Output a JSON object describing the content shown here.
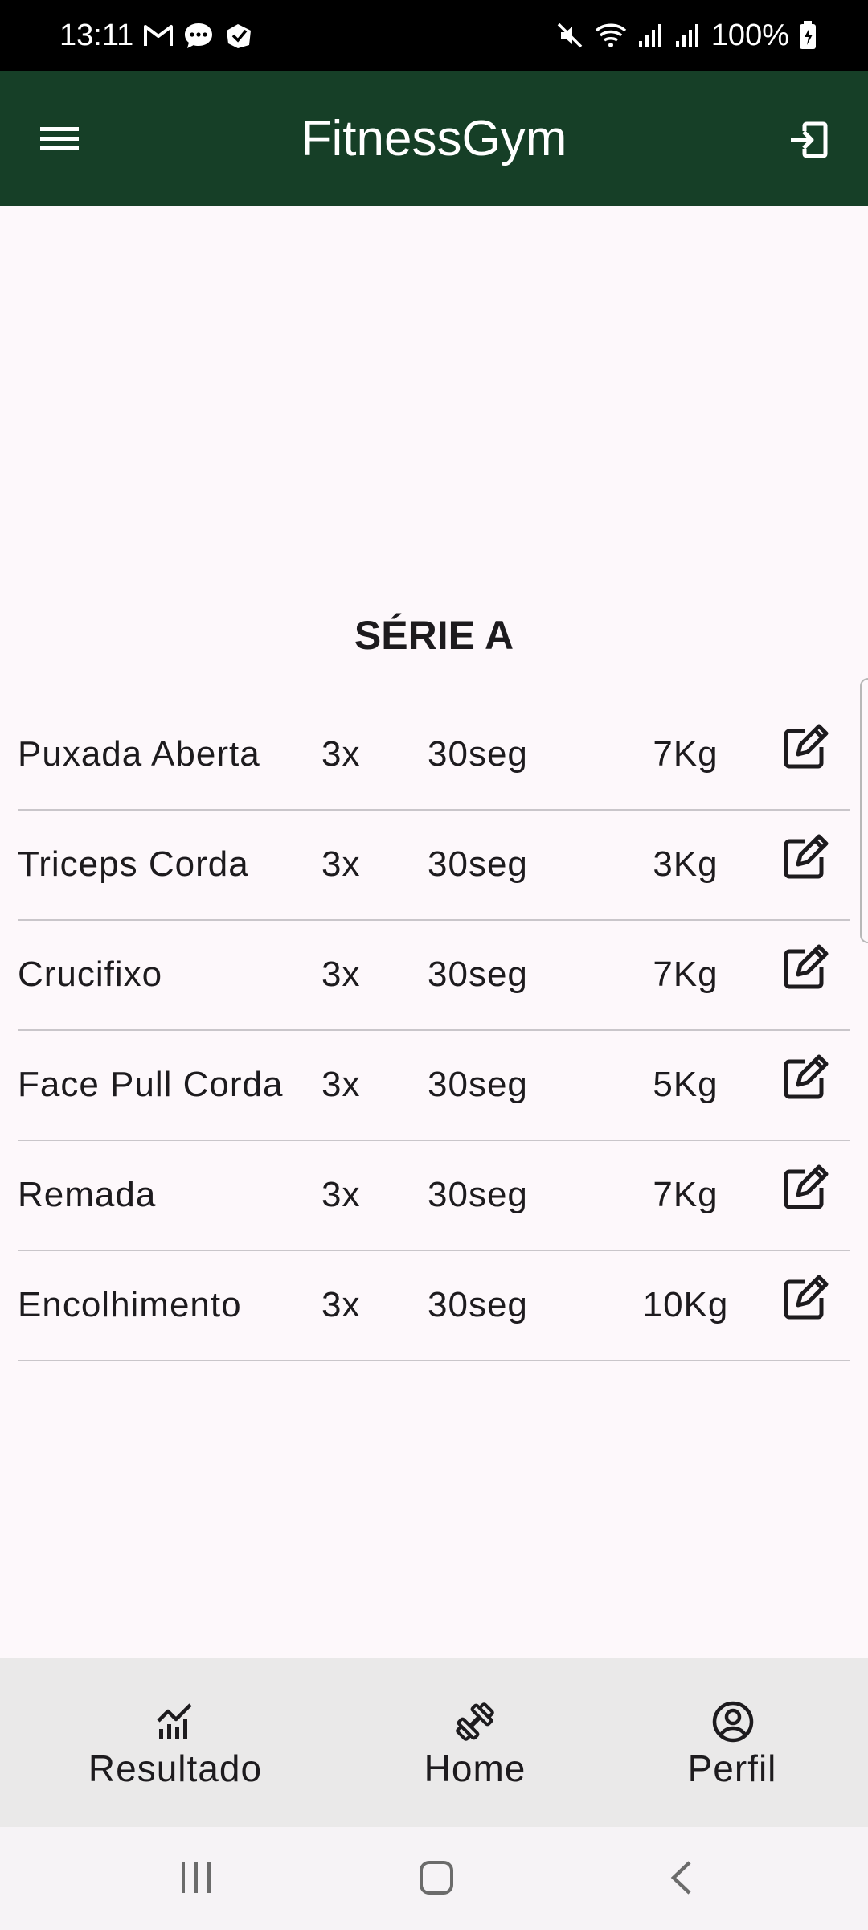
{
  "status_bar": {
    "time": "13:11",
    "notification_icons": [
      "gmail-icon",
      "chat-bubble-icon",
      "app-notification-icon"
    ],
    "system_icons": [
      "mute-icon",
      "wifi-icon",
      "signal-icon",
      "signal-icon",
      "battery-charging-icon"
    ],
    "battery": "100%"
  },
  "app_bar": {
    "title": "FitnessGym",
    "menu_icon": "menu-icon",
    "logout_icon": "logout-icon"
  },
  "workout": {
    "title": "SÉRIE A",
    "exercises": [
      {
        "name": "Puxada Aberta",
        "sets": "3x",
        "rest": "30seg",
        "weight": "7Kg"
      },
      {
        "name": "Triceps Corda",
        "sets": "3x",
        "rest": "30seg",
        "weight": "3Kg"
      },
      {
        "name": "Crucifixo",
        "sets": "3x",
        "rest": "30seg",
        "weight": "7Kg"
      },
      {
        "name": "Face Pull Corda",
        "sets": "3x",
        "rest": "30seg",
        "weight": "5Kg"
      },
      {
        "name": "Remada",
        "sets": "3x",
        "rest": "30seg",
        "weight": "7Kg"
      },
      {
        "name": "Encolhimento",
        "sets": "3x",
        "rest": "30seg",
        "weight": "10Kg"
      }
    ],
    "edit_icon": "edit-icon"
  },
  "bottom_nav": {
    "items": [
      {
        "label": "Resultado",
        "icon": "chart-icon"
      },
      {
        "label": "Home",
        "icon": "dumbbell-icon"
      },
      {
        "label": "Perfil",
        "icon": "account-circle-icon"
      }
    ]
  },
  "system_nav": {
    "buttons": [
      "recents-icon",
      "home-icon",
      "back-icon"
    ]
  },
  "colors": {
    "app_bar": "#163f27",
    "background": "#fdf8fb",
    "bottom_nav": "#eae9e9",
    "divider": "#c9c6ca"
  }
}
